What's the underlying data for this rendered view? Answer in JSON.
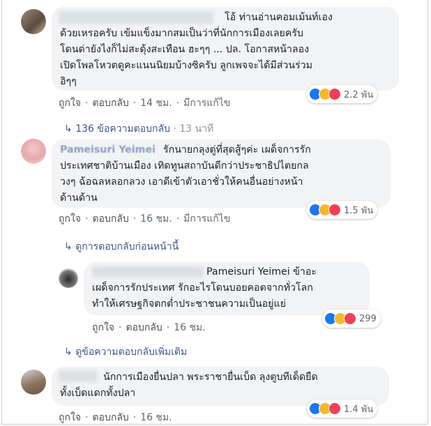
{
  "comments": [
    {
      "lines": [
        "โอ้ ท่านอ่านคอมเม้นท์เอง",
        "ด้วยเหรอครับ เข้มแข็งมากสมเป็นว่าที่นักการเมืองเลยครับ",
        "โดนด่ายังไงก็ไม่สะดุ้งสะเทือน ฮะๆๆ ... ปล. โอกาสหน้าลอง",
        "เปิดโพลโหวตดูคะแนนนิยมบ้างซิครับ ลูกเพจจะได้มีส่วนร่วม",
        "อิๆๆ"
      ],
      "like": "ถูกใจ",
      "reply": "ตอบกลับ",
      "time": "14 ชม.",
      "edited": "มีการแก้ไข",
      "reaction_count": "2.2 พัน"
    },
    {
      "name": "Pameisuri Yeimei",
      "lines": [
        "รักนายกลุงตู่ที่สุดสู้ๆค่ะ เผด็จการรัก",
        "ประเทศชาติบ้านเมือง เทิดทูนสถาบันดีกว่าประชาธิปไตยกล",
        "วงๆ ฉ้อฉลหลอกลวง เอาดีเข้าตัวเอาชั่วให้คนอื่นอย่างหน้า",
        "ด้านด้าน"
      ],
      "like": "ถูกใจ",
      "reply": "ตอบกลับ",
      "time": "16 ชม.",
      "edited": "มีการแก้ไข",
      "reaction_count": "1.5 พัน"
    },
    {
      "tag": "Pameisuri Yeimei",
      "lines": [
        "ข้าอะ",
        "เผด็จการรักประเทศ รักอะไรโดนบอยคอตจากทั่วโลก",
        "ทำให้เศรษฐกิจตกต่ำประชาชนความเป็นอยู่แย่"
      ],
      "like": "ถูกใจ",
      "reply": "ตอบกลับ",
      "time": "16 ชม.",
      "reaction_count": "299"
    },
    {
      "lines": [
        "นักการเมืองยื่นปลา พระราชายื่นเบ็ด ลุงตูบทีเด็ดยืด",
        "ทั้งเบ็ดแดกทั้งปลา"
      ],
      "like": "ถูกใจ",
      "reply": "ตอบกลับ",
      "time": "16 ชม.",
      "reaction_count": "1.4 พัน"
    }
  ],
  "replies_summary": {
    "text": "136 ข้อความตอบกลับ",
    "time": "13 นาที"
  },
  "view_previous": "ดูการตอบกลับก่อนหน้านี้",
  "view_more": "ดูข้อความตอบกลับเพิ่มเติม",
  "separator": "·",
  "colors": {
    "link": "#385898",
    "bubble": "#f2f3f5",
    "like": "#1877f2",
    "haha": "#f7b928",
    "love": "#f33e58"
  }
}
